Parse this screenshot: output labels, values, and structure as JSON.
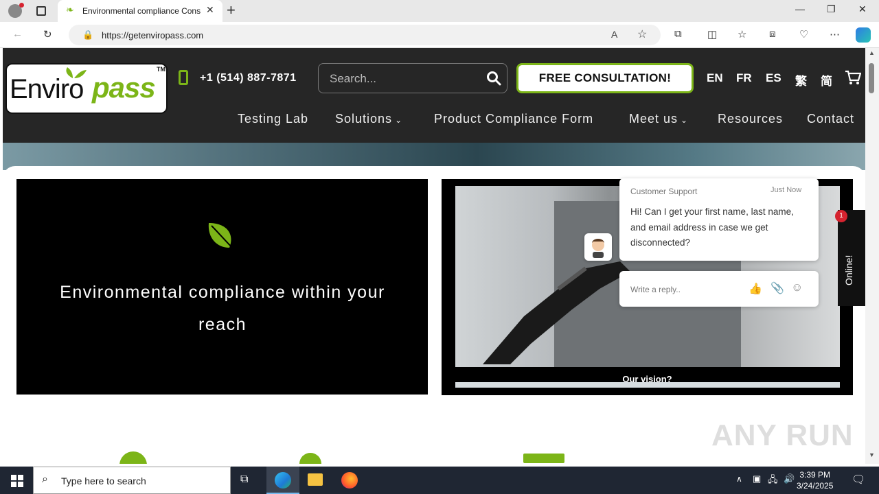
{
  "browser": {
    "tab_title": "Environmental compliance Cons",
    "url": "https://getenviropass.com"
  },
  "header": {
    "logo_enviro": "Enviro",
    "logo_pass": "pass",
    "logo_tm": "TM",
    "phone": "+1 (514) 887-7871",
    "search_placeholder": "Search...",
    "consult_label": "FREE CONSULTATION!",
    "languages": [
      "EN",
      "FR",
      "ES",
      "繁",
      "简"
    ]
  },
  "nav": {
    "items": [
      "Testing Lab",
      "Solutions",
      "Product Compliance Form",
      "Meet us",
      "Resources",
      "Contact"
    ]
  },
  "hero": {
    "tagline": "Environmental compliance within your reach",
    "video_caption": "Our vision?"
  },
  "chat": {
    "agent": "Customer Support",
    "time": "Just Now",
    "message": "Hi! Can I get your first name, last name, and email address in case we get disconnected?",
    "reply_placeholder": "Write a reply..",
    "online_label": "Online!",
    "badge_count": "1"
  },
  "watermark": "ANY RUN",
  "taskbar": {
    "search_placeholder": "Type here to search",
    "time": "3:39 PM",
    "date": "3/24/2025"
  },
  "colors": {
    "brand_green": "#7cb518",
    "header_bg": "#262626"
  }
}
